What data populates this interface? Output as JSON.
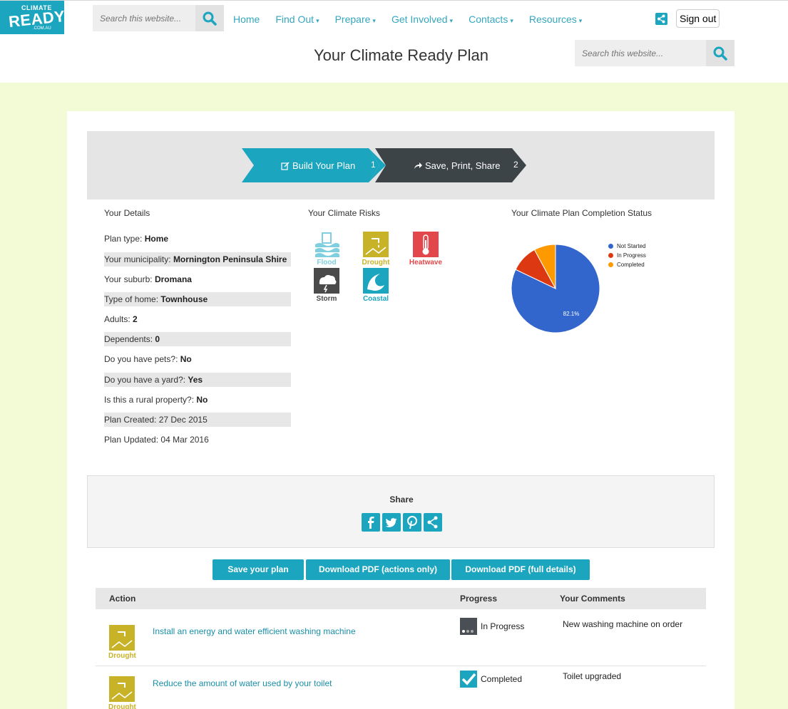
{
  "logo": {
    "line1": "CLIMATE",
    "line2": "READY",
    "line3": ".COM.AU"
  },
  "nav": {
    "search_placeholder": "Search this website...",
    "links": [
      {
        "label": "Home",
        "caret": ""
      },
      {
        "label": "Find Out",
        "caret": "▾"
      },
      {
        "label": "Prepare",
        "caret": "▾"
      },
      {
        "label": "Get Involved",
        "caret": "▾"
      },
      {
        "label": "Contacts",
        "caret": "▾"
      },
      {
        "label": "Resources",
        "caret": "▾"
      }
    ],
    "signout": "Sign out"
  },
  "page": {
    "title": "Your Climate Ready Plan",
    "search_placeholder": "Search this website..."
  },
  "steps": [
    {
      "label": "Build Your Plan",
      "num": "1"
    },
    {
      "label": "Save, Print, Share",
      "num": "2"
    }
  ],
  "details": {
    "heading": "Your Details",
    "rows": [
      {
        "label": "Plan type: ",
        "value": "Home"
      },
      {
        "label": "Your municipality: ",
        "value": "Mornington Peninsula Shire"
      },
      {
        "label": "Your suburb: ",
        "value": "Dromana"
      },
      {
        "label": "Type of home: ",
        "value": "Townhouse"
      },
      {
        "label": "Adults: ",
        "value": "2"
      },
      {
        "label": "Dependents: ",
        "value": "0"
      },
      {
        "label": "Do you have pets?: ",
        "value": "No"
      },
      {
        "label": "Do you have a yard?: ",
        "value": "Yes"
      },
      {
        "label": "Is this a rural property?: ",
        "value": "No"
      },
      {
        "label": "Plan Created: 27 Dec 2015",
        "value": ""
      },
      {
        "label": "Plan Updated: 04 Mar 2016",
        "value": ""
      }
    ]
  },
  "risks": {
    "heading": "Your Climate Risks",
    "items": [
      {
        "label": "Flood",
        "color": "#7fcfe0"
      },
      {
        "label": "Drought",
        "color": "#c8b227"
      },
      {
        "label": "Heatwave",
        "color": "#e2474b"
      },
      {
        "label": "Storm",
        "color": "#4a4a4a"
      },
      {
        "label": "Coastal",
        "color": "#1ba5bf"
      }
    ]
  },
  "chart_data": {
    "type": "pie",
    "title": "Your Climate Plan Completion Status",
    "series": [
      {
        "name": "Not Started",
        "value": 82.1,
        "color": "#3366cc"
      },
      {
        "name": "In Progress",
        "value": 10.0,
        "color": "#dc3912"
      },
      {
        "name": "Completed",
        "value": 7.9,
        "color": "#ff9900"
      }
    ],
    "slice_label": "82.1%",
    "legend_position": "right"
  },
  "share": {
    "label": "Share"
  },
  "buttons": {
    "save": "Save your plan",
    "pdf_actions": "Download PDF (actions only)",
    "pdf_full": "Download PDF (full details)"
  },
  "table": {
    "headers": {
      "action": "Action",
      "progress": "Progress",
      "comments": "Your Comments"
    },
    "rows": [
      {
        "badge": "Drought",
        "action": "Install an energy and water efficient washing machine",
        "progress": "In Progress",
        "comment": "New washing machine on order"
      },
      {
        "badge": "Drought",
        "action": "Reduce the amount of water used by your toilet",
        "progress": "Completed",
        "comment": "Toilet upgraded"
      }
    ]
  },
  "colors": {
    "accent": "#1ba5bf",
    "background": "#f2fbd6",
    "step2": "#3c4448"
  }
}
